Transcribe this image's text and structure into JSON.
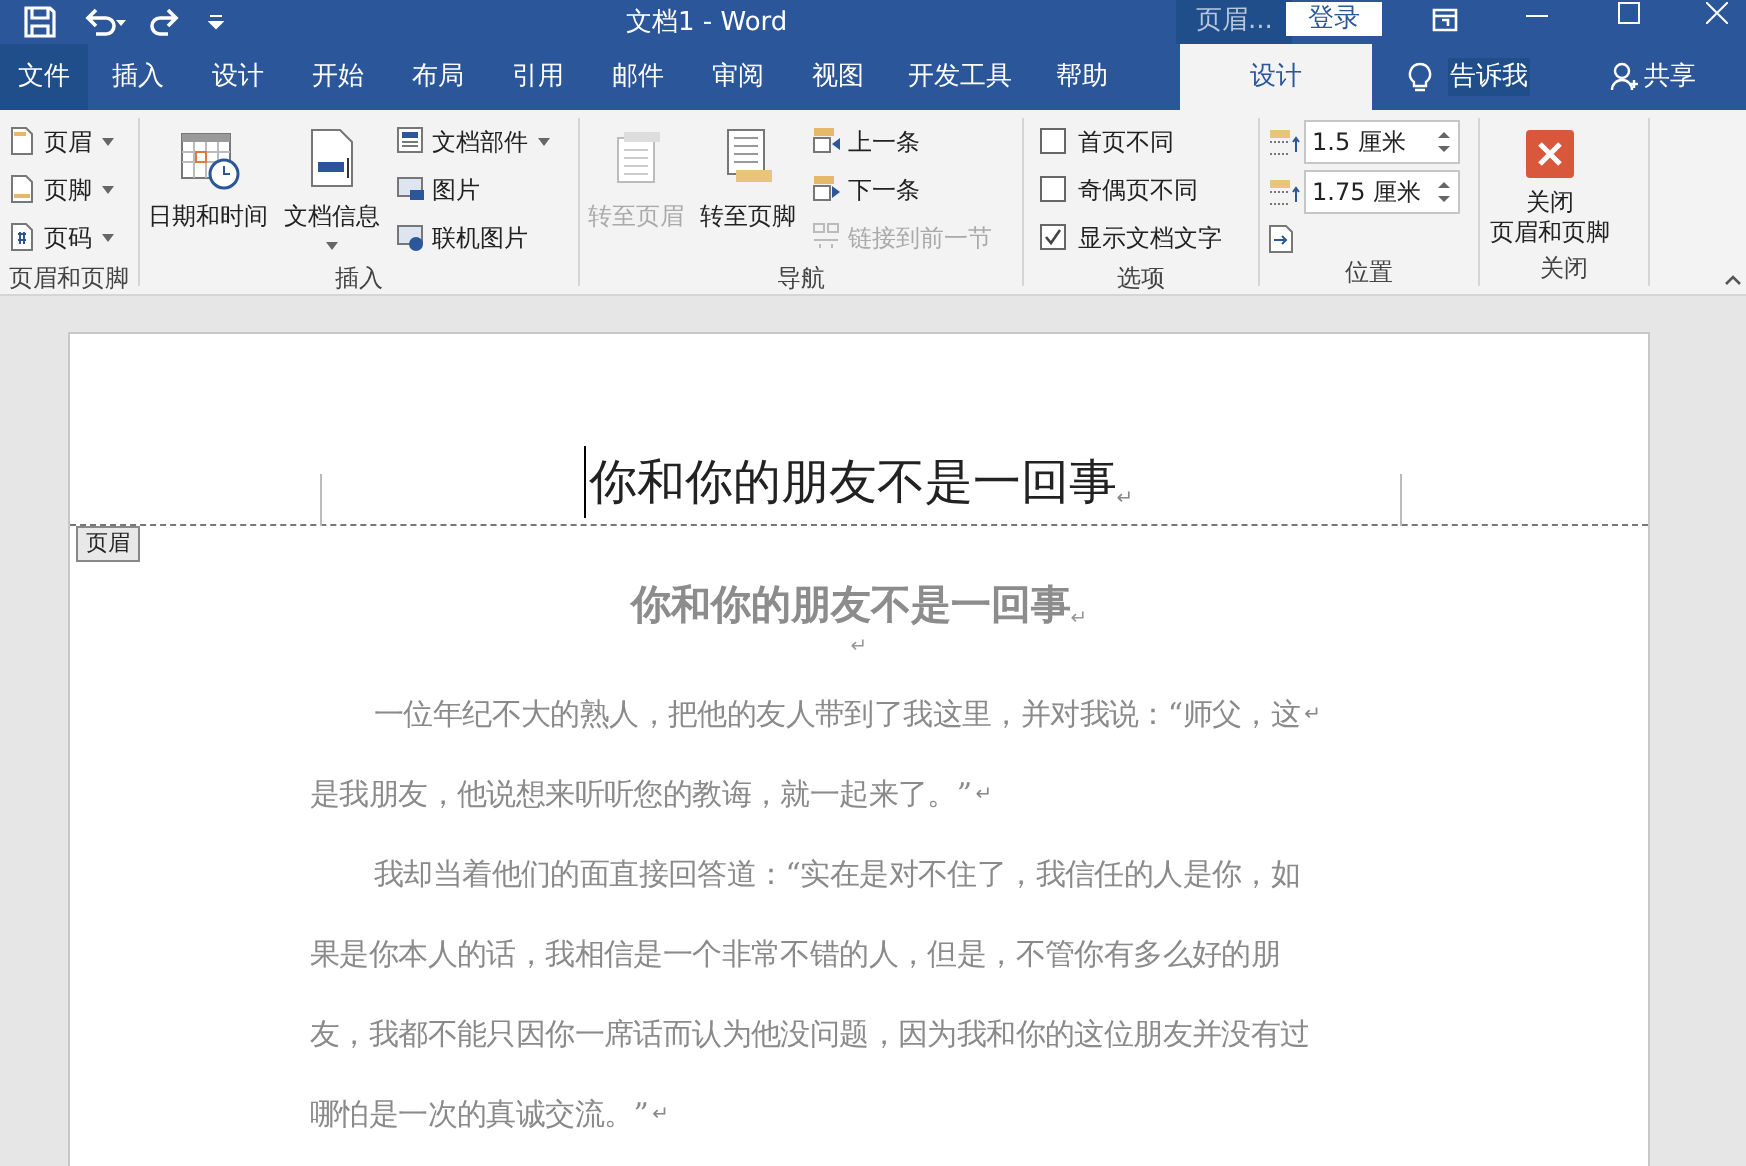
{
  "title_bar": {
    "title": "文档1  -  Word",
    "context_label": "页眉...",
    "sign_in": "登录"
  },
  "tabs": [
    {
      "label": "文件",
      "kind": "file",
      "selected": false
    },
    {
      "label": "插入",
      "kind": "normal",
      "selected": false
    },
    {
      "label": "设计",
      "kind": "normal",
      "selected": false
    },
    {
      "label": "开始",
      "kind": "normal",
      "selected": false
    },
    {
      "label": "布局",
      "kind": "normal",
      "selected": false
    },
    {
      "label": "引用",
      "kind": "normal",
      "selected": false
    },
    {
      "label": "邮件",
      "kind": "normal",
      "selected": false
    },
    {
      "label": "审阅",
      "kind": "normal",
      "selected": false
    },
    {
      "label": "视图",
      "kind": "normal",
      "selected": false
    },
    {
      "label": "开发工具",
      "kind": "normal",
      "selected": false
    },
    {
      "label": "帮助",
      "kind": "normal",
      "selected": false
    },
    {
      "label": "设计",
      "kind": "context",
      "selected": true
    }
  ],
  "tell_me": "告诉我",
  "share": "共享",
  "ribbon": {
    "groups": [
      {
        "label": "页眉和页脚",
        "columns": [
          [
            {
              "kind": "small",
              "label": "页眉",
              "dropdown": true
            },
            {
              "kind": "small",
              "label": "页脚",
              "dropdown": true
            },
            {
              "kind": "small",
              "label": "页码",
              "dropdown": true
            }
          ]
        ]
      },
      {
        "label": "插入",
        "columns": [
          [
            {
              "kind": "large",
              "label": "日期和时间",
              "dropdown": false
            }
          ],
          [
            {
              "kind": "large",
              "label": "文档信息",
              "dropdown": true
            }
          ],
          [
            {
              "kind": "small",
              "label": "文档部件",
              "dropdown": true
            },
            {
              "kind": "small",
              "label": "图片",
              "dropdown": false
            },
            {
              "kind": "small",
              "label": "联机图片",
              "dropdown": false
            }
          ]
        ]
      },
      {
        "label": "导航",
        "columns": [
          [
            {
              "kind": "large",
              "label": "转至页眉",
              "disabled": true
            }
          ],
          [
            {
              "kind": "large",
              "label": "转至页脚",
              "disabled": false
            }
          ],
          [
            {
              "kind": "small",
              "label": "上一条",
              "disabled": false
            },
            {
              "kind": "small",
              "label": "下一条",
              "disabled": false
            },
            {
              "kind": "small",
              "label": "链接到前一节",
              "disabled": true
            }
          ]
        ]
      },
      {
        "label": "选项",
        "columns": [
          [
            {
              "kind": "checkbox",
              "label": "首页不同",
              "checked": false
            },
            {
              "kind": "checkbox",
              "label": "奇偶页不同",
              "checked": false
            },
            {
              "kind": "checkbox",
              "label": "显示文档文字",
              "checked": true
            }
          ]
        ]
      },
      {
        "label": "位置",
        "columns": [
          [
            {
              "kind": "spinner",
              "value": "1.5 厘米"
            },
            {
              "kind": "spinner",
              "value": "1.75 厘米"
            },
            {
              "kind": "icon"
            }
          ]
        ]
      },
      {
        "label": "关闭",
        "columns": [
          [
            {
              "kind": "close",
              "label_lines": [
                "关闭",
                "页眉和页脚"
              ]
            }
          ]
        ]
      }
    ]
  },
  "document": {
    "header_text": "你和你的朋友不是一回事",
    "header_mark": "↵",
    "header_tag": "页眉",
    "heading": "你和你的朋友不是一回事",
    "heading_mark": "↵",
    "empty_mark": "↵",
    "paragraphs": [
      {
        "lines": [
          {
            "text": "一位年纪不大的熟人，把他的友人带到了我这里，并对我说：“师父，这",
            "mark": "↵"
          },
          {
            "text": "是我朋友，他说想来听听您的教诲，就一起来了。”",
            "mark": "↵"
          }
        ]
      },
      {
        "lines": [
          {
            "text": "我却当着他们的面直接回答道：“实在是对不住了，我信任的人是你，如"
          },
          {
            "text": "果是你本人的话，我相信是一个非常不错的人，但是，不管你有多么好的朋"
          },
          {
            "text": "友，我都不能只因你一席话而认为他没问题，因为我和你的这位朋友并没有过"
          },
          {
            "text": "哪怕是一次的真诚交流。”",
            "mark": "↵"
          }
        ]
      }
    ]
  }
}
